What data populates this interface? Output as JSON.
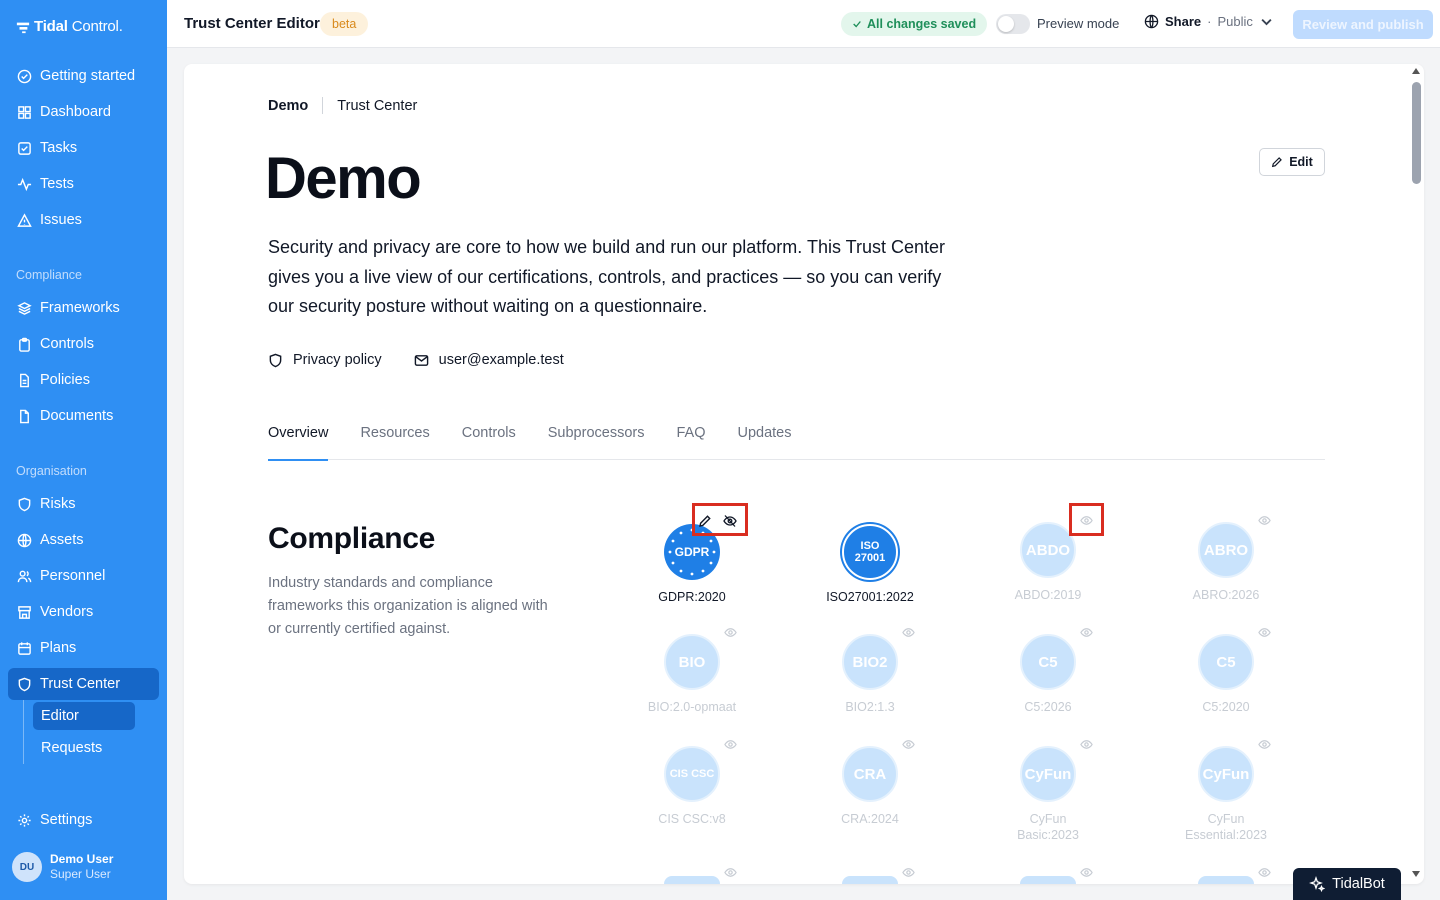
{
  "app": {
    "brand_bold": "Tidal",
    "brand_light": "Control."
  },
  "sidebar": {
    "primary": [
      {
        "label": "Getting started",
        "icon": "check-circle-icon"
      },
      {
        "label": "Dashboard",
        "icon": "grid-icon"
      },
      {
        "label": "Tasks",
        "icon": "checkbox-icon"
      },
      {
        "label": "Tests",
        "icon": "activity-icon"
      },
      {
        "label": "Issues",
        "icon": "warning-icon"
      }
    ],
    "compliance_heading": "Compliance",
    "compliance": [
      {
        "label": "Frameworks",
        "icon": "layers-icon"
      },
      {
        "label": "Controls",
        "icon": "clipboard-icon"
      },
      {
        "label": "Policies",
        "icon": "file-icon"
      },
      {
        "label": "Documents",
        "icon": "document-icon"
      }
    ],
    "organisation_heading": "Organisation",
    "organisation": [
      {
        "label": "Risks",
        "icon": "shield-icon"
      },
      {
        "label": "Assets",
        "icon": "globe-icon"
      },
      {
        "label": "Personnel",
        "icon": "users-icon"
      },
      {
        "label": "Vendors",
        "icon": "store-icon"
      },
      {
        "label": "Plans",
        "icon": "calendar-icon"
      },
      {
        "label": "Trust Center",
        "icon": "shield-icon"
      }
    ],
    "trust_sub": [
      {
        "label": "Editor"
      },
      {
        "label": "Requests"
      }
    ],
    "settings": "Settings",
    "user": {
      "initials": "DU",
      "name": "Demo User",
      "role": "Super User"
    }
  },
  "topbar": {
    "title": "Trust Center Editor",
    "beta": "beta",
    "saved": "All changes saved",
    "preview": "Preview mode",
    "share": "Share",
    "share_sep": "·",
    "share_visibility": "Public",
    "publish": "Review and publish"
  },
  "page": {
    "crumb_org": "Demo",
    "crumb_page": "Trust Center",
    "edit": "Edit",
    "title": "Demo",
    "intro": "Security and privacy are core to how we build and run our platform. This Trust Center gives you a live view of our certifications, controls, and practices — so you can verify our security posture without waiting on a questionnaire.",
    "privacy": "Privacy policy",
    "email": "user@example.test",
    "tabs": [
      "Overview",
      "Resources",
      "Controls",
      "Subprocessors",
      "FAQ",
      "Updates"
    ],
    "compliance_title": "Compliance",
    "compliance_desc": "Industry standards and compliance frameworks this organization is aligned with or currently certified against."
  },
  "frameworks": [
    {
      "badge": "GDPR",
      "label": "GDPR:2020",
      "visible": true
    },
    {
      "badge": "ISO 27001",
      "badge_top": "ISO",
      "badge_bottom": "27001",
      "label": "ISO27001:2022",
      "visible": true
    },
    {
      "badge": "ABDO",
      "label": "ABDO:2019",
      "visible": false
    },
    {
      "badge": "ABRO",
      "label": "ABRO:2026",
      "visible": false
    },
    {
      "badge": "BIO",
      "label": "BIO:2.0-opmaat",
      "visible": false
    },
    {
      "badge": "BIO2",
      "label": "BIO2:1.3",
      "visible": false
    },
    {
      "badge": "C5",
      "label": "C5:2026",
      "visible": false
    },
    {
      "badge": "C5",
      "label": "C5:2020",
      "visible": false
    },
    {
      "badge": "CIS CSC",
      "label": "CIS CSC:v8",
      "visible": false
    },
    {
      "badge": "CRA",
      "label": "CRA:2024",
      "visible": false
    },
    {
      "badge": "CyFun",
      "label": "CyFun Basic:2023",
      "visible": false
    },
    {
      "badge": "CyFun",
      "label": "CyFun Essential:2023",
      "visible": false
    }
  ],
  "chatbot": {
    "label": "TidalBot"
  },
  "colors": {
    "sidebar": "#2f8ff3",
    "active": "#1667c8",
    "badge": "#1f7fe6",
    "highlight": "#d92d20"
  }
}
